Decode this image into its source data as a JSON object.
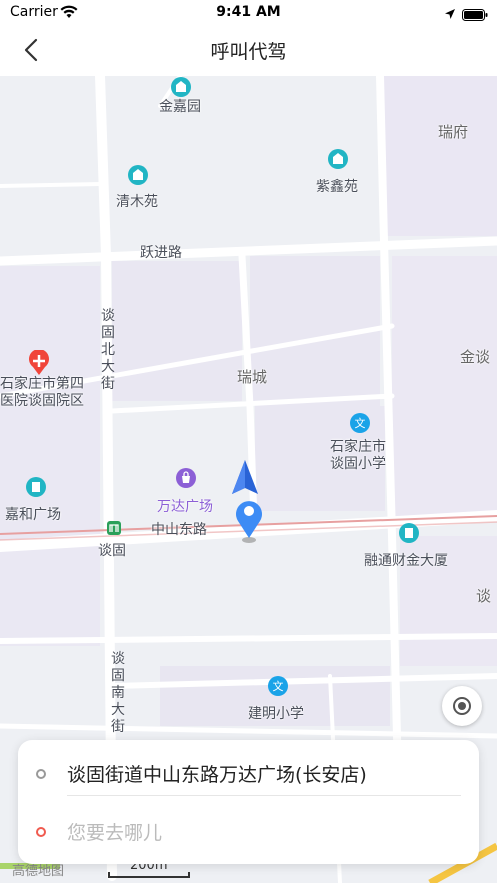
{
  "status_bar": {
    "carrier": "Carrier",
    "time": "9:41 AM"
  },
  "nav": {
    "title": "呼叫代驾"
  },
  "map": {
    "pois": [
      {
        "id": "jinjiayuan",
        "name": "金嘉园",
        "icon": "residential-icon",
        "color": "#21b5c4"
      },
      {
        "id": "qingmuyuan",
        "name": "清木苑",
        "icon": "residential-icon",
        "color": "#21b5c4"
      },
      {
        "id": "zixinyuan",
        "name": "紫鑫苑",
        "icon": "residential-icon",
        "color": "#21b5c4"
      },
      {
        "id": "ruifu",
        "name": "瑞府"
      },
      {
        "id": "ruicheng",
        "name": "瑞城"
      },
      {
        "id": "jintan",
        "name": "金谈"
      },
      {
        "id": "hospital",
        "name": "石家庄市第四医院谈固院区",
        "line1": "石家庄市第四",
        "line2": "医院谈固院区",
        "icon": "hospital-icon",
        "color": "#f0453a"
      },
      {
        "id": "school1",
        "name": "石家庄市谈固小学",
        "line1": "石家庄市",
        "line2": "谈固小学",
        "icon": "school-icon",
        "color": "#1aa3e8"
      },
      {
        "id": "jiahe",
        "name": "嘉和广场",
        "icon": "building-icon",
        "color": "#21b5c4"
      },
      {
        "id": "wanda",
        "name": "万达广场",
        "icon": "shopping-icon",
        "color": "#8c5fd6"
      },
      {
        "id": "rongtong",
        "name": "融通财金大厦",
        "icon": "building-icon",
        "color": "#21b5c4"
      },
      {
        "id": "tan",
        "name": "谈"
      },
      {
        "id": "tangu",
        "name": "谈固"
      },
      {
        "id": "jianming",
        "name": "建明小学",
        "icon": "school-icon",
        "color": "#1aa3e8"
      }
    ],
    "roads": {
      "yuejin": "跃进路",
      "zhongshan_east": "中山东路",
      "tangu_north": "谈固北大街",
      "tangu_south": "谈固南大街"
    },
    "scale_label": "200m",
    "logo": "高德地图"
  },
  "trip": {
    "origin": "谈固街道中山东路万达广场(长安店)",
    "destination_placeholder": "您要去哪儿"
  }
}
